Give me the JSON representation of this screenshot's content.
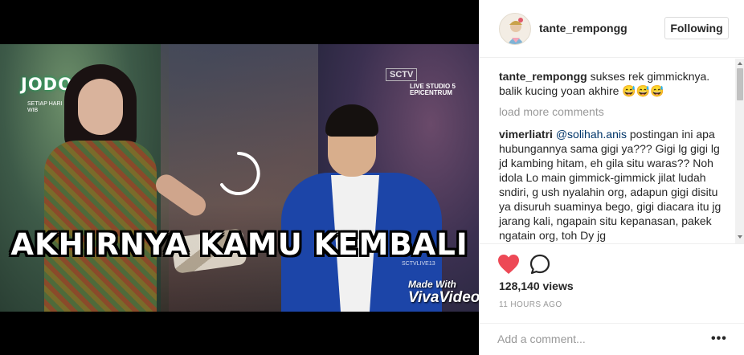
{
  "video": {
    "show_logo": "JODOH",
    "show_schedule": "SETIAP HARI 19.00 - 22.00 WIB",
    "channel_badge": "SCTV",
    "live_text": "LIVE STUDIO 5 EPICENTRUM",
    "caption_overlay": "AKHIRNYA KAMU KEMBALI",
    "small_tag": "SCTVLIVE13",
    "watermark_line1": "Made With",
    "watermark_line2": "VivaVideo"
  },
  "post": {
    "username": "tante_rempongg",
    "follow_label": "Following",
    "views": "128,140 views",
    "timestamp": "11 HOURS AGO"
  },
  "comments": {
    "caption": {
      "author": "tante_rempongg",
      "text": " sukses rek gimmicknya. balik kucing yoan akhire ",
      "emoji": "😅😅😅"
    },
    "load_more": "load more comments",
    "items": [
      {
        "author": "vimerliatri",
        "mention": "@solihah.anis",
        "text": " postingan ini apa hubungannya sama gigi ya??? Gigi lg gigi lg jd kambing hitam, eh gila situ waras?? Noh idola Lo main gimmick-gimmick jilat ludah sndiri, g ush nyalahin org, adapun gigi disitu ya disuruh suaminya bego, gigi diacara itu jg jarang kali, ngapain situ kepanasan, pakek ngatain org, toh Dy jg"
      }
    ]
  },
  "add_comment": {
    "placeholder": "Add a comment...",
    "more_label": "•••"
  },
  "icons": {
    "like": "heart-icon",
    "comment": "comment-icon",
    "loading": "loading-spinner-icon"
  },
  "colors": {
    "like_red": "#ed4956",
    "mention_blue": "#003569",
    "muted_gray": "#999999"
  }
}
